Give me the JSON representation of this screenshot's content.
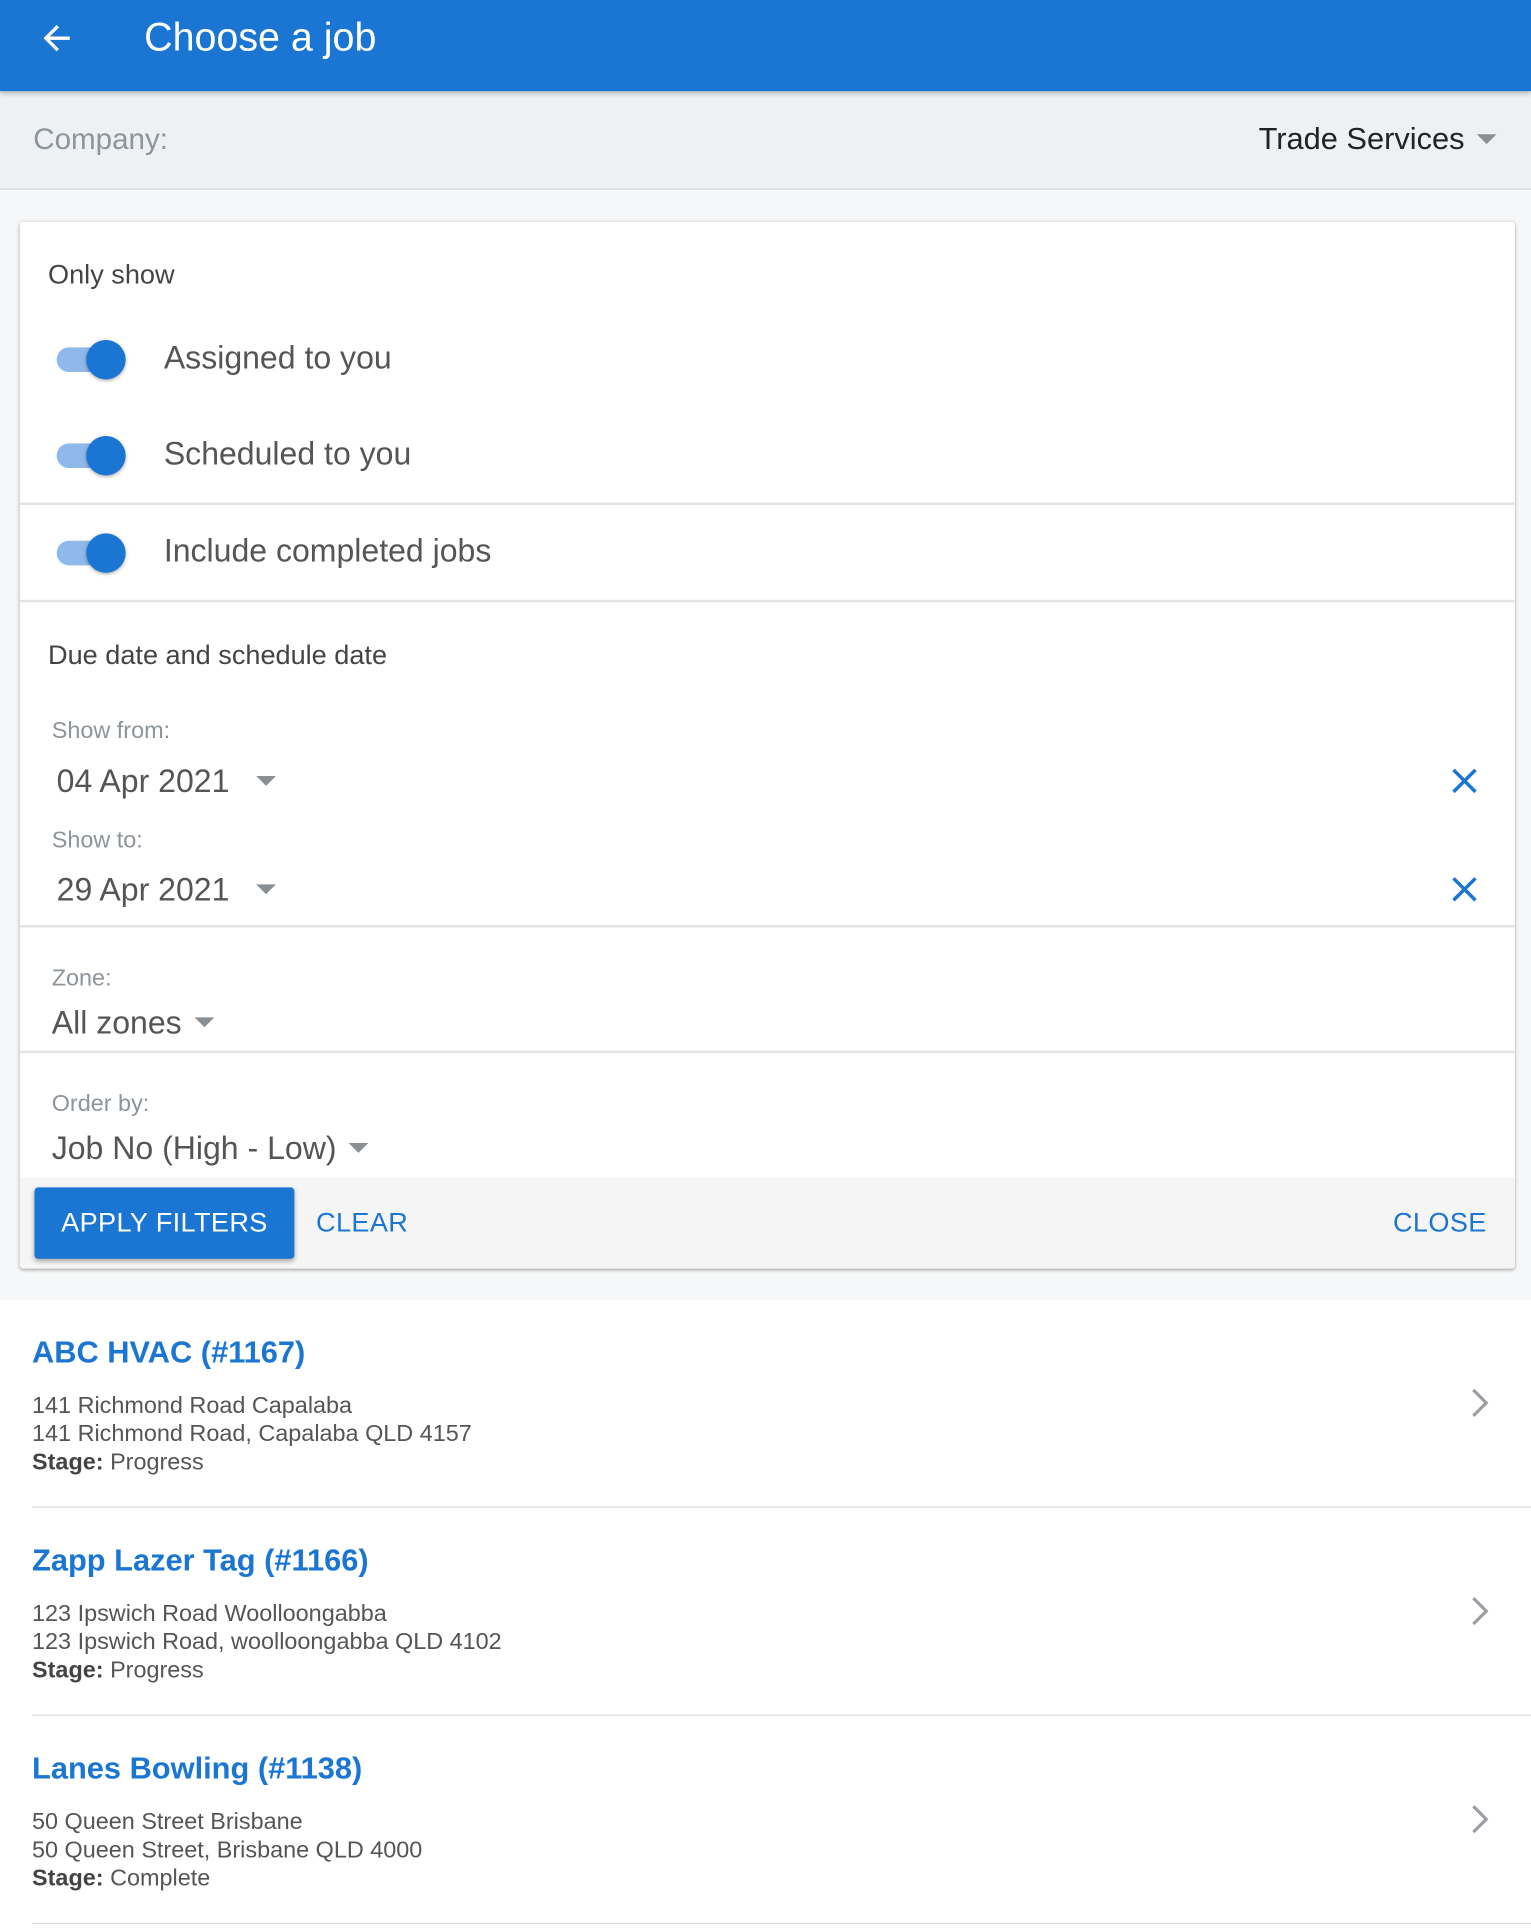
{
  "header": {
    "title": "Choose a job",
    "back_icon": "arrow-left-icon"
  },
  "company": {
    "label": "Company:",
    "value": "Trade Services"
  },
  "filters": {
    "only_show_title": "Only show",
    "toggles": [
      {
        "label": "Assigned to you",
        "on": true
      },
      {
        "label": "Scheduled to you",
        "on": true
      },
      {
        "label": "Include completed jobs",
        "on": true
      }
    ],
    "date_section_title": "Due date and schedule date",
    "show_from": {
      "label": "Show from:",
      "value": "04 Apr 2021"
    },
    "show_to": {
      "label": "Show to:",
      "value": "29 Apr 2021"
    },
    "zone": {
      "label": "Zone:",
      "value": "All zones"
    },
    "order_by": {
      "label": "Order by:",
      "value": "Job No (High - Low)"
    },
    "apply_label": "APPLY FILTERS",
    "clear_label": "CLEAR",
    "close_label": "CLOSE"
  },
  "jobs": [
    {
      "title": "ABC HVAC (#1167)",
      "site": "141 Richmond Road Capalaba",
      "address": "141 Richmond Road, Capalaba QLD 4157",
      "stage_label": "Stage:",
      "stage": "Progress"
    },
    {
      "title": "Zapp Lazer Tag (#1166)",
      "site": "123 Ipswich Road Woolloongabba",
      "address": "123 Ipswich Road, woolloongabba QLD 4102",
      "stage_label": "Stage:",
      "stage": "Progress"
    },
    {
      "title": "Lanes Bowling (#1138)",
      "site": "50 Queen Street Brisbane",
      "address": "50 Queen Street, Brisbane QLD 4000",
      "stage_label": "Stage:",
      "stage": "Complete"
    }
  ],
  "colors": {
    "primary": "#1b76d3",
    "toolbar_bg": "#edf1f4"
  }
}
